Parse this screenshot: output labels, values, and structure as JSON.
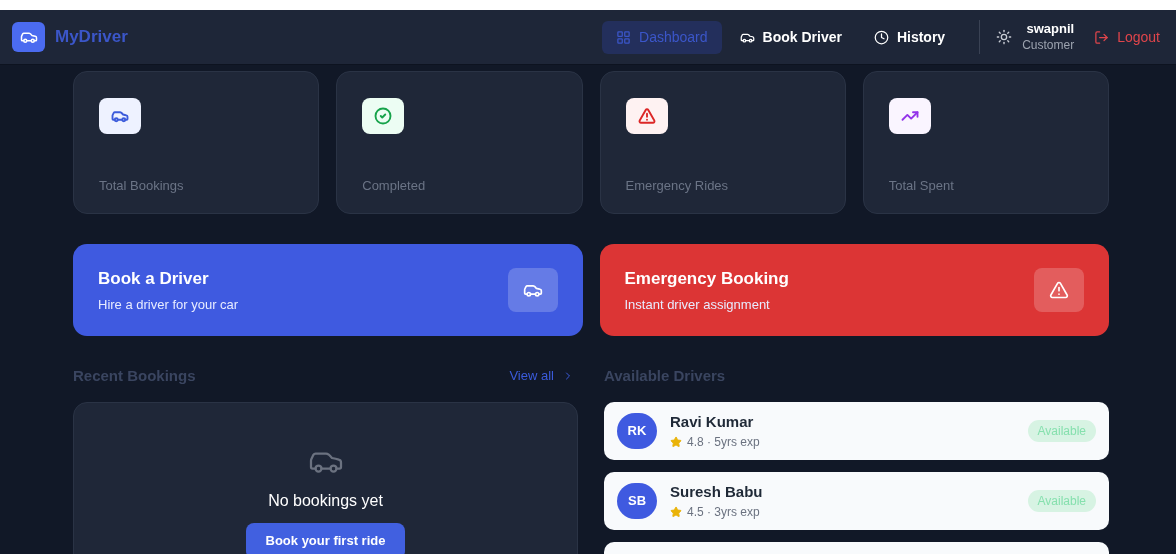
{
  "brand": {
    "name": "MyDriver"
  },
  "nav": {
    "items": [
      {
        "label": "Dashboard",
        "selected": true
      },
      {
        "label": "Book Driver",
        "selected": false
      },
      {
        "label": "History",
        "selected": false
      }
    ],
    "user": {
      "name": "swapnil",
      "role": "Customer"
    },
    "logout": "Logout"
  },
  "stats": [
    {
      "label": "Total Bookings",
      "color": "#3b5bdb"
    },
    {
      "label": "Completed",
      "color": "#16a34a"
    },
    {
      "label": "Emergency Rides",
      "color": "#dc2626"
    },
    {
      "label": "Total Spent",
      "color": "#9333ea"
    }
  ],
  "actions": [
    {
      "kind": "book",
      "title": "Book a Driver",
      "subtitle": "Hire a driver for your car"
    },
    {
      "kind": "emergency",
      "title": "Emergency Booking",
      "subtitle": "Instant driver assignment"
    }
  ],
  "recent_bookings": {
    "title": "Recent Bookings",
    "view_all": "View all",
    "empty_text": "No bookings yet",
    "button": "Book your first ride"
  },
  "available_drivers": {
    "title": "Available Drivers",
    "drivers": [
      {
        "initials": "RK",
        "name": "Ravi Kumar",
        "meta": "4.8 · 5yrs exp",
        "status": "Available"
      },
      {
        "initials": "SB",
        "name": "Suresh Babu",
        "meta": "4.5 · 3yrs exp",
        "status": "Available"
      }
    ]
  }
}
